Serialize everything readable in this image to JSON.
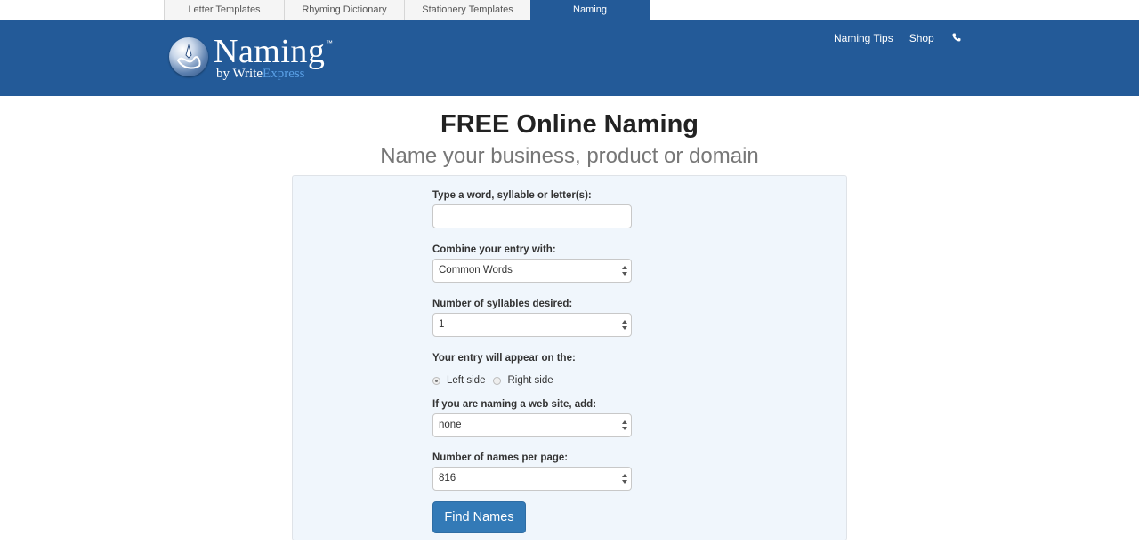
{
  "top_tabs": [
    {
      "label": "Letter Templates",
      "active": false
    },
    {
      "label": "Rhyming Dictionary",
      "active": false
    },
    {
      "label": "Stationery Templates",
      "active": false
    },
    {
      "label": "Naming",
      "active": true
    }
  ],
  "header": {
    "logo": {
      "word": "Naming",
      "tm": "™",
      "by": "by Write",
      "express": "Express",
      "icon": "globe-pen-logo-icon"
    },
    "nav": [
      {
        "label": "Naming Tips"
      },
      {
        "label": "Shop"
      }
    ],
    "phone_icon": "phone-icon"
  },
  "page": {
    "title": "FREE Online Naming",
    "subtitle": "Name your business, product or domain"
  },
  "form": {
    "word": {
      "label": "Type a word, syllable or letter(s):",
      "value": "",
      "placeholder": ""
    },
    "combine": {
      "label": "Combine your entry with:",
      "value": "Common Words"
    },
    "syllables": {
      "label": "Number of syllables desired:",
      "value": "1"
    },
    "position": {
      "label": "Your entry will appear on the:",
      "options": [
        {
          "label": "Left side",
          "checked": true
        },
        {
          "label": "Right side",
          "checked": false
        }
      ]
    },
    "website": {
      "label": "If you are naming a web site, add:",
      "value": "none"
    },
    "per_page": {
      "label": "Number of names per page:",
      "value": "816"
    },
    "submit_label": "Find Names"
  },
  "colors": {
    "brand_blue": "#235a98",
    "button_blue": "#337ab7",
    "panel_bg": "#f0f6fc",
    "logo_express": "#5aa0e6"
  }
}
